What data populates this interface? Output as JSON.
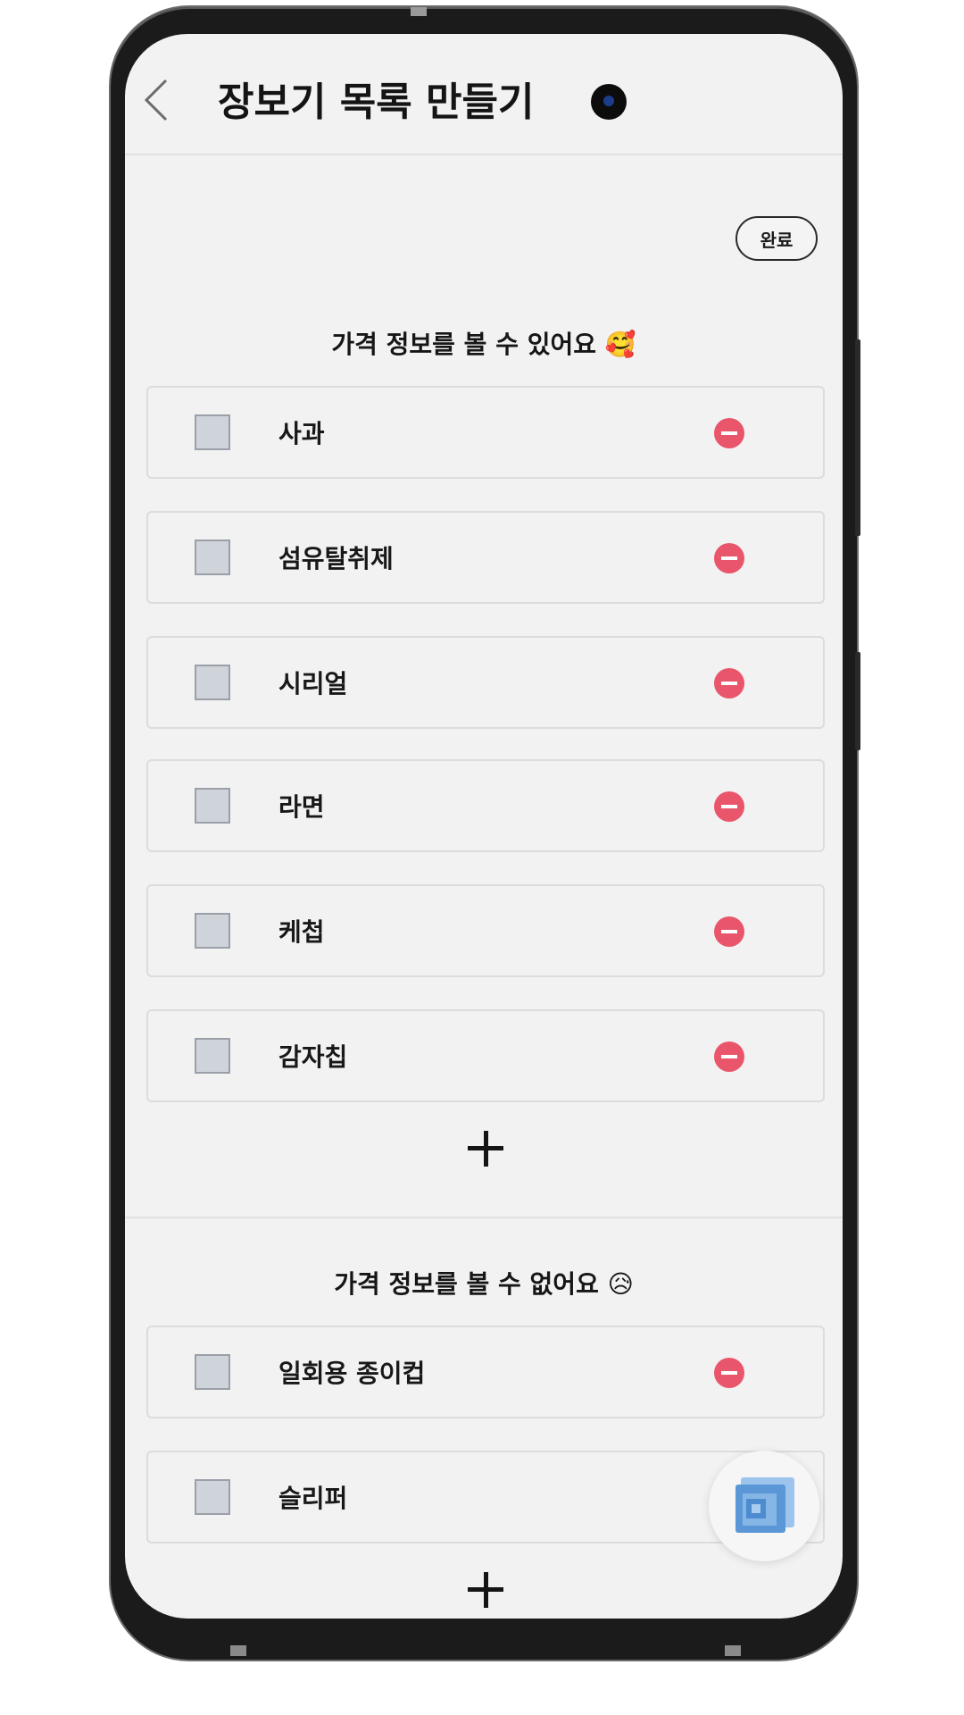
{
  "header": {
    "title": "장보기 목록 만들기"
  },
  "toolbar": {
    "done_label": "완료"
  },
  "section_priced": {
    "title": "가격 정보를 볼 수 있어요 🥰",
    "items": [
      {
        "label": "사과"
      },
      {
        "label": "섬유탈취제"
      },
      {
        "label": "시리얼"
      },
      {
        "label": "라면"
      },
      {
        "label": "케첩"
      },
      {
        "label": "감자칩"
      }
    ]
  },
  "section_unpriced": {
    "title": "가격 정보를 볼 수 없어요 😥",
    "items": [
      {
        "label": "일회용 종이컵"
      },
      {
        "label": "슬리퍼"
      }
    ]
  },
  "colors": {
    "screen_bg": "#f2f2f2",
    "remove_accent": "#e9556b",
    "fab_accent": "#6fa8e0"
  }
}
